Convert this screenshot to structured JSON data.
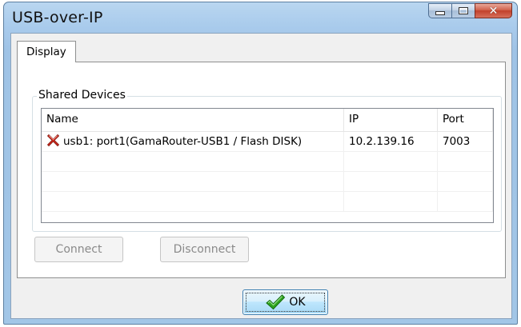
{
  "window": {
    "title": "USB-over-IP",
    "minimize_icon": "minimize-icon",
    "maximize_icon": "maximize-icon",
    "close_icon": "close-icon"
  },
  "tabs": [
    {
      "label": "Display",
      "active": true
    }
  ],
  "shared_devices": {
    "group_label": "Shared Devices",
    "columns": [
      {
        "label": "Name"
      },
      {
        "label": "IP"
      },
      {
        "label": "Port"
      },
      {
        "label": ""
      }
    ],
    "rows": [
      {
        "status_icon": "red-x-icon",
        "name": "usb1: port1(GamaRouter-USB1 / Flash DISK)",
        "ip": "10.2.139.16",
        "port": "7003"
      }
    ]
  },
  "buttons": {
    "connect": "Connect",
    "disconnect": "Disconnect",
    "ok": "OK"
  },
  "colors": {
    "titlebar": "#a9cbec",
    "close_button": "#c2402a",
    "ok_button": "#bee6fd",
    "disabled_text": "#8a8a8a"
  }
}
